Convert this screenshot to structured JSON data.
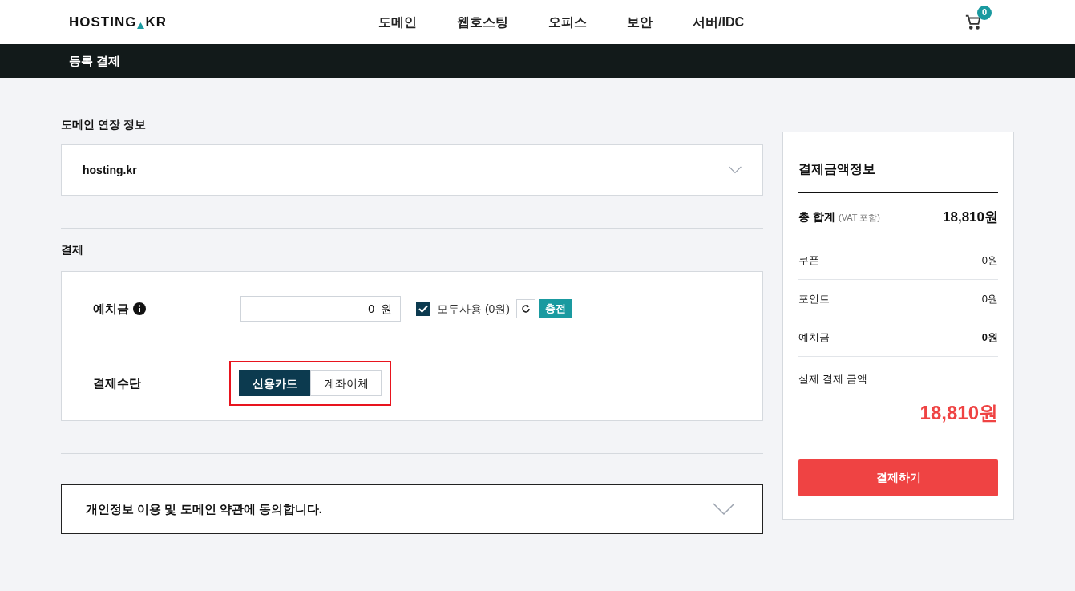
{
  "header": {
    "logo": {
      "left": "HOSTING",
      "right": "KR"
    },
    "nav": [
      "도메인",
      "웹호스팅",
      "오피스",
      "보안",
      "서버/IDC"
    ],
    "cart_count": "0"
  },
  "title_bar": {
    "title": "등록 결제"
  },
  "domain_section": {
    "title": "도메인 연장 정보",
    "domain": "hosting.kr",
    "expanded": false
  },
  "payment": {
    "title": "결제",
    "deposit": {
      "label": "예치금",
      "value": "0",
      "unit": "원",
      "use_all": {
        "label": "모두사용 (0원)",
        "checked": true
      },
      "charge": "충전"
    },
    "method": {
      "label": "결제수단",
      "highlighted": true,
      "options": [
        {
          "label": "신용카드",
          "selected": true
        },
        {
          "label": "계좌이체",
          "selected": false
        }
      ]
    }
  },
  "agreement": {
    "text": "개인정보 이용 및 도메인 약관에 동의합니다.",
    "expanded": false
  },
  "summary": {
    "title": "결제금액정보",
    "total_label": "총 합계",
    "total_note": "(VAT 포함)",
    "total": "18,810원",
    "rows": [
      {
        "label": "쿠폰",
        "value": "0원",
        "bold": false
      },
      {
        "label": "포인트",
        "value": "0원",
        "bold": false
      },
      {
        "label": "예치금",
        "value": "0원",
        "bold": true
      }
    ],
    "final_label": "실제 결제 금액",
    "final": "18,810원",
    "pay_button": "결제하기"
  }
}
